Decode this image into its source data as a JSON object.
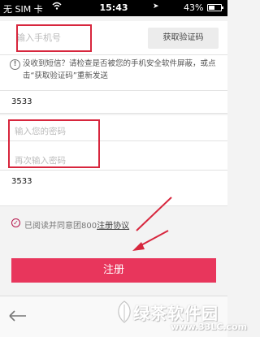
{
  "status_bar": {
    "carrier": "无 SIM 卡",
    "time": "15:43",
    "battery_percent": "43%",
    "battery_level": 0.43
  },
  "form": {
    "phone_placeholder": "输入手机号",
    "get_code_label": "获取验证码",
    "notice": "没收到短信？请检查是否被您的手机安全软件屏蔽，或点击“获取验证码”重新发送",
    "verification_code": "3533",
    "password_placeholder": "输入您的密码",
    "confirm_password_placeholder": "再次输入密码",
    "second_code": "3533"
  },
  "agreement": {
    "text": "已阅读并同意团800",
    "link": "注册协议"
  },
  "register_button_label": "注册",
  "watermark": {
    "title": "绿茶软件园",
    "url": "www.33LC.com"
  },
  "colors": {
    "accent": "#e8365c",
    "annotation": "#d7263d"
  }
}
